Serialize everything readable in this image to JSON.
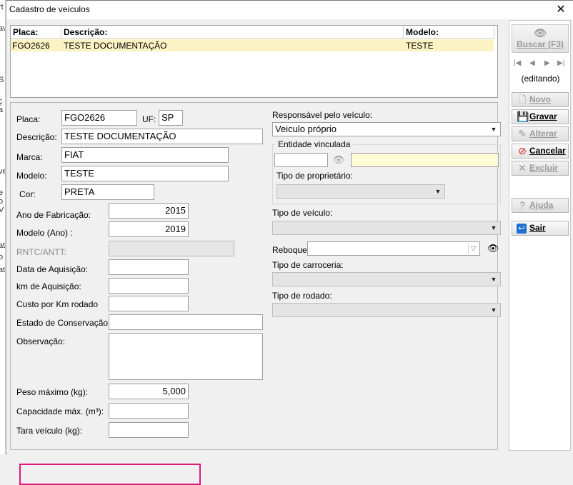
{
  "window": {
    "title": "Cadastro de veículos",
    "close_glyph": "✕"
  },
  "grid": {
    "headers": {
      "placa": "Placa:",
      "descricao": "Descrição:",
      "modelo": "Modelo:"
    },
    "rows": [
      {
        "placa": "FGO2626",
        "descricao": "TESTE DOCUMENTAÇÃO",
        "modelo": "TESTE"
      }
    ],
    "selected_row_color": "#fcf3c4"
  },
  "form": {
    "placa": {
      "label": "Placa:",
      "value": "FGO2626"
    },
    "uf": {
      "label": "UF:",
      "value": "SP"
    },
    "descricao": {
      "label": "Descrição:",
      "value": "TESTE DOCUMENTAÇÃO"
    },
    "marca": {
      "label": "Marca:",
      "value": "FIAT"
    },
    "modelo": {
      "label": "Modelo:",
      "value": "TESTE"
    },
    "cor": {
      "label": "Cor:",
      "value": "PRETA"
    },
    "ano_fabricacao": {
      "label": "Ano de Fabricação:",
      "value": "2015"
    },
    "modelo_ano": {
      "label": "Modelo (Ano) :",
      "value": "2019"
    },
    "rntc": {
      "label": "RNTC/ANTT:",
      "value": ""
    },
    "data_aquisicao": {
      "label": "Data de Aquisição:",
      "value": ""
    },
    "km_aquisicao": {
      "label": "km de Aquisição:",
      "value": ""
    },
    "custo_km": {
      "label": "Custo por Km rodado",
      "value": ""
    },
    "estado_conservacao": {
      "label": "Estado de Conservação:",
      "value": ""
    },
    "observacao": {
      "label": "Observação:",
      "value": ""
    },
    "peso_maximo": {
      "label": "Peso máximo (kg):",
      "value": "5,000"
    },
    "capacidade": {
      "label": "Capacidade máx. (m³):",
      "value": ""
    },
    "tara": {
      "label": "Tara veículo (kg):",
      "value": ""
    },
    "responsavel": {
      "label": "Responsável pelo veículo:",
      "value": "Veiculo próprio"
    },
    "entidade": {
      "title": "Entidade vinculada",
      "code": "",
      "name": ""
    },
    "tipo_proprietario": {
      "label": "Tipo de proprietário:",
      "value": ""
    },
    "tipo_veiculo": {
      "label": "Tipo de veículo:",
      "value": ""
    },
    "reboque": {
      "label": "Reboque:",
      "value": ""
    },
    "tipo_carroceria": {
      "label": "Tipo de carroceria:",
      "value": ""
    },
    "tipo_rodado": {
      "label": "Tipo de rodado:",
      "value": ""
    },
    "highlight_color": "#e0197d"
  },
  "toolbar": {
    "buscar": "Buscar (F3)",
    "nav_glyphs": [
      "|◀",
      "◀",
      "▶",
      "▶|"
    ],
    "status": "(editando)",
    "novo": "Novo",
    "gravar": "Gravar",
    "alterar": "Alterar",
    "cancelar": "Cancelar",
    "excluir": "Excluir",
    "ajuda": "Ajuda",
    "sair": "Sair"
  },
  "icons": {
    "binoculars": "binoculars-icon",
    "new": "new-document-icon",
    "save": "floppy-disk-icon",
    "edit": "pencil-icon",
    "cancel": "cancel-icon",
    "delete": "x-icon",
    "help": "question-icon",
    "exit": "exit-icon"
  },
  "background_app": {
    "fragments": [
      "rt",
      "av",
      "S",
      "ç",
      "a",
      "ve",
      "e",
      "o",
      "V",
      "at",
      "o",
      "at"
    ]
  }
}
